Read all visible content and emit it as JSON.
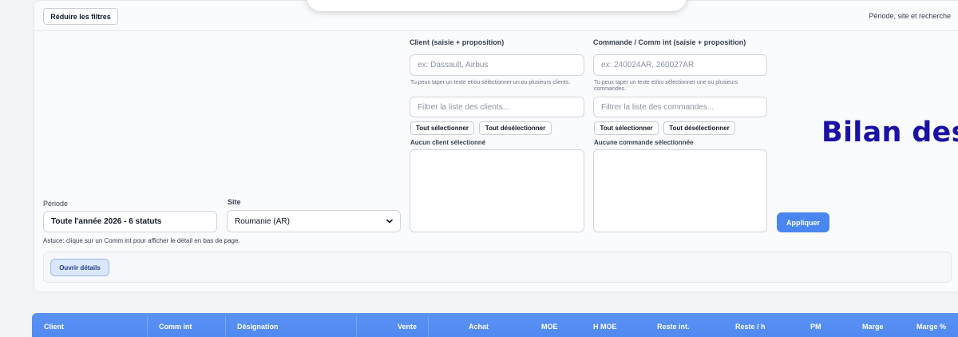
{
  "header": {
    "collapse_label": "Réduire les filtres",
    "right_title": "Période, site et recherche"
  },
  "client": {
    "label": "Client (saisie + proposition)",
    "placeholder": "ex: Dassault, Airbus",
    "help": "Tu peux taper un texte et/ou sélectionner un ou plusieurs clients.",
    "filter_placeholder": "Filtrer la liste des clients...",
    "select_all": "Tout sélectionner",
    "deselect_all": "Tout désélectionner",
    "none_selected": "Aucun client sélectionné"
  },
  "commande": {
    "label": "Commande / Comm int (saisie + proposition)",
    "placeholder": "ex: 240024AR, 260027AR",
    "help": "Tu peux taper un texte et/ou sélectionner une ou plusieurs commandes.",
    "filter_placeholder": "Filtrer la liste des commandes...",
    "select_all": "Tout sélectionner",
    "deselect_all": "Tout désélectionner",
    "none_selected": "Aucune commande sélectionnée"
  },
  "periode": {
    "label": "Période",
    "value": "Toute l'année 2026 - 6 statuts"
  },
  "site": {
    "label": "Site",
    "value": "Roumanie (AR)"
  },
  "apply_label": "Appliquer",
  "bilan_title": "Bilan des",
  "tip": "Astuce: clique sur un Comm int pour afficher le détail en bas de page.",
  "details_label": "Ouvrir détails",
  "table": {
    "columns": [
      "Client",
      "Comm int",
      "Désignation",
      "Vente",
      "Achat",
      "MOE",
      "H MOE",
      "Reste int.",
      "Reste / h",
      "PM",
      "Marge",
      "Marge %"
    ]
  },
  "colors": {
    "accent": "#4a86f0",
    "title": "#1a12a6",
    "table_header": "#5b92f5"
  }
}
